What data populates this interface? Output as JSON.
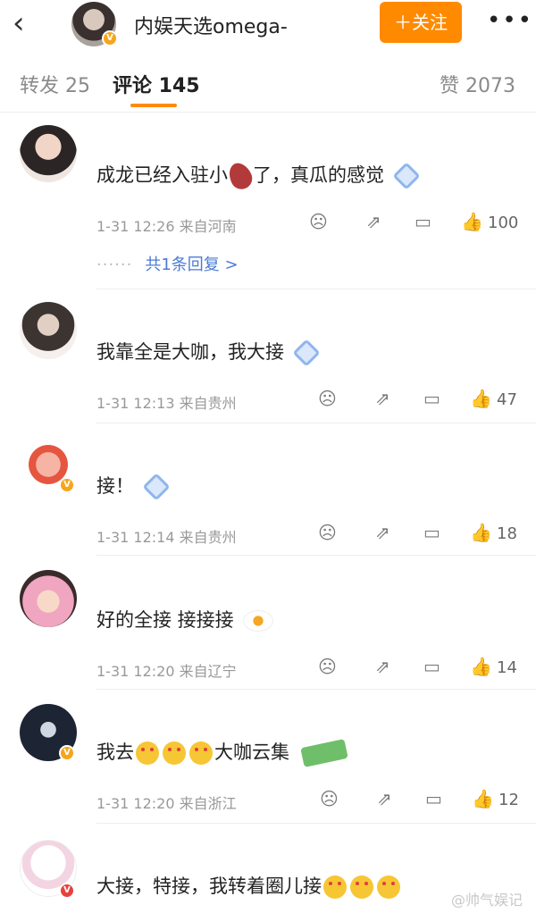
{
  "header": {
    "back_icon": "back-chevron-icon",
    "user_name": "内娱天选omega-",
    "follow_label": "＋关注",
    "more_icon": "more-dots-icon"
  },
  "tabs": [
    {
      "label": "转发 25",
      "active": false
    },
    {
      "label": "评论 145",
      "active": true
    },
    {
      "label": "赞 2073",
      "active": false
    }
  ],
  "comments": [
    {
      "text": "成龙已经入驻小",
      "text_after": "了，真瓜的感觉",
      "time": "1-31 12:26",
      "location": "来自河南",
      "likes": "100",
      "replies": "共1条回复 >"
    },
    {
      "text": "我靠全是大咖，我大接",
      "time": "1-31 12:13",
      "location": "来自贵州",
      "likes": "47"
    },
    {
      "text": "接！",
      "time": "1-31 12:14",
      "location": "来自贵州",
      "likes": "18"
    },
    {
      "text": "好的全接 接接接",
      "time": "1-31 12:20",
      "location": "来自辽宁",
      "likes": "14"
    },
    {
      "text_before": "我去",
      "text": "大咖云集",
      "time": "1-31 12:20",
      "location": "来自浙江",
      "likes": "12"
    },
    {
      "text": "大接，特接，我转着圈儿接"
    }
  ],
  "watermark": "@帅气娱记",
  "colors": {
    "accent": "#ff8a00",
    "link": "#4b7bd6",
    "muted": "#999999"
  }
}
